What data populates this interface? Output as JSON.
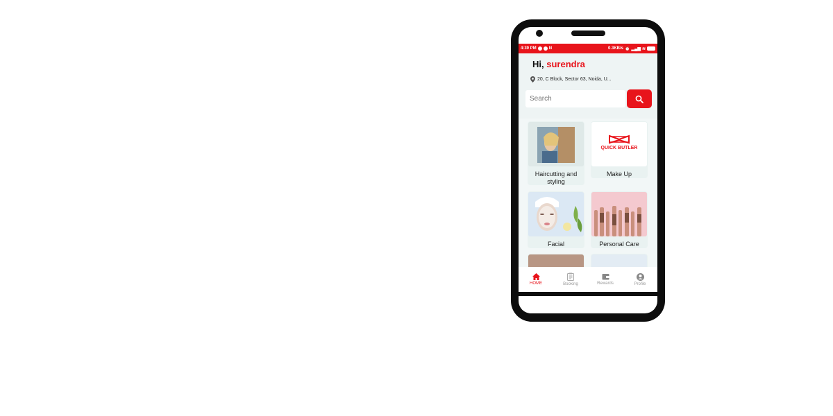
{
  "status_bar": {
    "time": "4:39 PM",
    "network_speed": "0.3KB/s",
    "battery": "39"
  },
  "header": {
    "greeting_prefix": "Hi,",
    "user_name": "surendra",
    "address": "20, C Block, Sector 63, Noida, U..."
  },
  "search": {
    "placeholder": "Search"
  },
  "categories": [
    {
      "label": "Haircutting and styling"
    },
    {
      "label": "Make Up",
      "logo_text": "QUICK BUTLER"
    },
    {
      "label": "Facial"
    },
    {
      "label": "Personal Care"
    }
  ],
  "bottom_nav": [
    {
      "label": "HOME",
      "icon": "home-icon",
      "active": true
    },
    {
      "label": "Booking",
      "icon": "clipboard-icon",
      "active": false
    },
    {
      "label": "Rewards",
      "icon": "wallet-icon",
      "active": false
    },
    {
      "label": "Profile",
      "icon": "user-icon",
      "active": false
    }
  ],
  "colors": {
    "accent": "#e8141b",
    "background": "#eef4f4"
  }
}
